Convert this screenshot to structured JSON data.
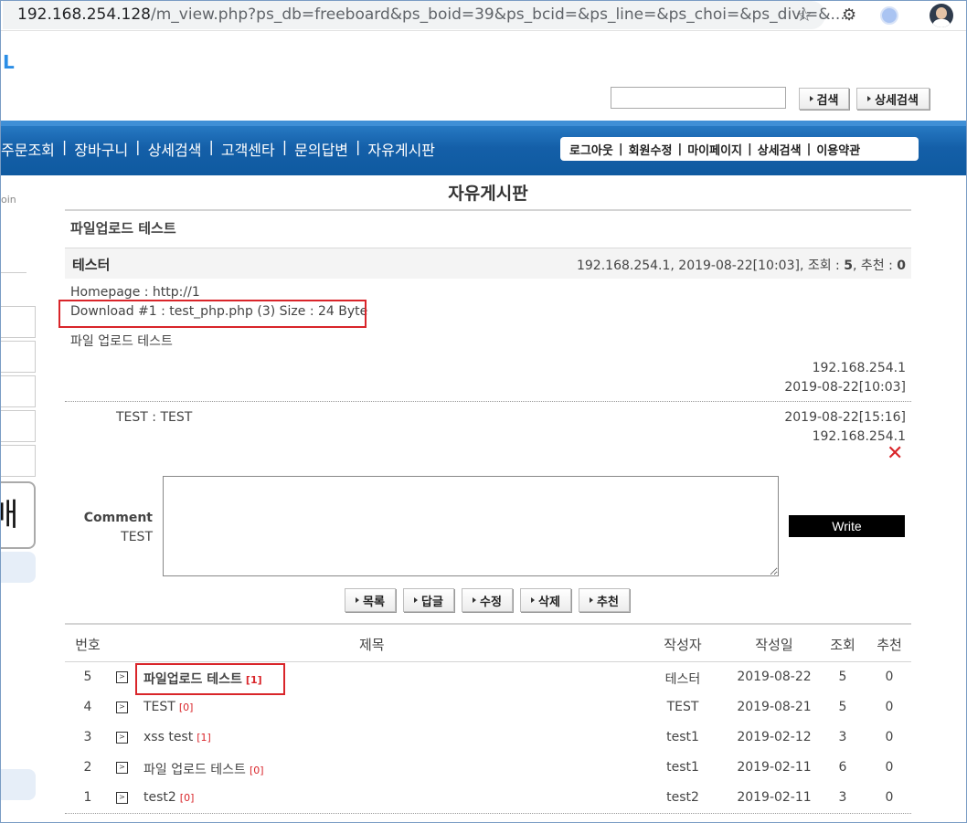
{
  "browser": {
    "url_host": "192.168.254.128",
    "url_rest": "/m_view.php?ps_db=freeboard&ps_boid=39&ps_bcid=&ps_line=&ps_choi=&ps_divi=&..."
  },
  "header": {
    "logo_fragment": "L",
    "search_button": "검색",
    "advanced_search_button": "상세검색"
  },
  "nav": {
    "items": [
      "주문조회",
      "장바구니",
      "상세검색",
      "고객센타",
      "문의답변",
      "자유게시판"
    ],
    "right_items": [
      "로그아웃",
      "회원수정",
      "마이페이지",
      "상세검색",
      "이용약관"
    ]
  },
  "sidebar": {
    "login_fragment": "oin",
    "big_char": "매"
  },
  "board": {
    "title": "자유게시판",
    "post": {
      "subject": "파일업로드 테스트",
      "author": "테스터",
      "meta_prefix": "192.168.254.1, 2019-08-22[10:03], 조회 : ",
      "views": "5",
      "meta_mid": ", 추천 : ",
      "recommends": "0",
      "homepage": "Homepage : http://1",
      "download": "Download #1 : test_php.php (3) Size : 24 Byte",
      "body": "파일 업로드 테스트",
      "ip": "192.168.254.1",
      "datetime": "2019-08-22[10:03]"
    },
    "comment": {
      "user": "TEST :   TEST",
      "datetime": "2019-08-22[15:16]",
      "ip": "192.168.254.1",
      "delete_icon": "✕"
    },
    "comment_form": {
      "label": "Comment",
      "user": "TEST",
      "textarea_value": "",
      "write_button": "Write"
    },
    "actions": [
      "목록",
      "답글",
      "수정",
      "삭제",
      "추천"
    ],
    "table": {
      "headers": [
        "번호",
        "제목",
        "작성자",
        "작성일",
        "조회",
        "추천"
      ],
      "rows": [
        {
          "num": "5",
          "subject": "파일업로드 테스트",
          "comments": "[1]",
          "writer": "테스터",
          "date": "2019-08-22",
          "views": "5",
          "rec": "0"
        },
        {
          "num": "4",
          "subject": "TEST",
          "comments": "[0]",
          "writer": "TEST",
          "date": "2019-08-21",
          "views": "5",
          "rec": "0"
        },
        {
          "num": "3",
          "subject": "xss test",
          "comments": "[1]",
          "writer": "test1",
          "date": "2019-02-12",
          "views": "3",
          "rec": "0"
        },
        {
          "num": "2",
          "subject": "파일 업로드 테스트",
          "comments": "[0]",
          "writer": "test1",
          "date": "2019-02-11",
          "views": "6",
          "rec": "0"
        },
        {
          "num": "1",
          "subject": "test2",
          "comments": "[0]",
          "writer": "test2",
          "date": "2019-02-11",
          "views": "3",
          "rec": "0"
        }
      ]
    }
  },
  "colors": {
    "nav_blue": "#145fa8",
    "highlight_red": "#d9252a",
    "comment_count": "#d9252a"
  }
}
